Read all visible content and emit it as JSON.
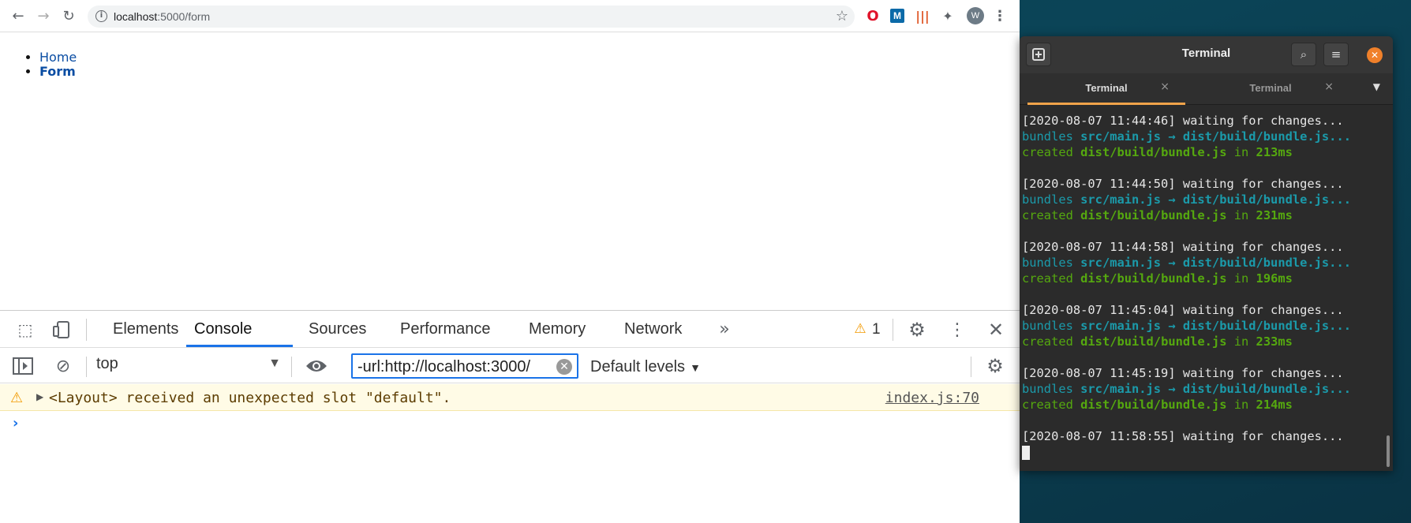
{
  "browser": {
    "url_host": "localhost",
    "url_rest": ":5000/form",
    "extensions": [
      "opera-icon",
      "m-extension-icon",
      "audio-extension-icon",
      "puzzle-icon"
    ],
    "profile_initial": "W"
  },
  "page": {
    "nav": [
      {
        "label": "Home"
      },
      {
        "label": "Form"
      }
    ]
  },
  "devtools": {
    "tabs": [
      "Elements",
      "Console",
      "Sources",
      "Performance",
      "Memory",
      "Network"
    ],
    "active_tab": "Console",
    "more": "»",
    "warning_count": "1",
    "context": "top",
    "filter_value": "-url:http://localhost:3000/",
    "levels": "Default levels",
    "messages": [
      {
        "level": "warning",
        "text": "<Layout> received an unexpected slot \"default\".",
        "source": "index.js:70"
      }
    ]
  },
  "terminal": {
    "title": "Terminal",
    "tabs": [
      {
        "label": "Terminal",
        "active": true
      },
      {
        "label": "Terminal",
        "active": false
      }
    ],
    "blocks": [
      {
        "time": "[2020-08-07 11:44:46] waiting for changes...",
        "bundles": "bundles",
        "src": "src/main.js",
        "arrow": "→",
        "dest": "dist/build/bundle.js...",
        "created": "created",
        "file": "dist/build/bundle.js",
        "in": "in",
        "ms": "213ms"
      },
      {
        "time": "[2020-08-07 11:44:50] waiting for changes...",
        "bundles": "bundles",
        "src": "src/main.js",
        "arrow": "→",
        "dest": "dist/build/bundle.js...",
        "created": "created",
        "file": "dist/build/bundle.js",
        "in": "in",
        "ms": "231ms"
      },
      {
        "time": "[2020-08-07 11:44:58] waiting for changes...",
        "bundles": "bundles",
        "src": "src/main.js",
        "arrow": "→",
        "dest": "dist/build/bundle.js...",
        "created": "created",
        "file": "dist/build/bundle.js",
        "in": "in",
        "ms": "196ms"
      },
      {
        "time": "[2020-08-07 11:45:04] waiting for changes...",
        "bundles": "bundles",
        "src": "src/main.js",
        "arrow": "→",
        "dest": "dist/build/bundle.js...",
        "created": "created",
        "file": "dist/build/bundle.js",
        "in": "in",
        "ms": "233ms"
      },
      {
        "time": "[2020-08-07 11:45:19] waiting for changes...",
        "bundles": "bundles",
        "src": "src/main.js",
        "arrow": "→",
        "dest": "dist/build/bundle.js...",
        "created": "created",
        "file": "dist/build/bundle.js",
        "in": "in",
        "ms": "214ms"
      }
    ],
    "last_line": "[2020-08-07 11:58:55] waiting for changes..."
  }
}
